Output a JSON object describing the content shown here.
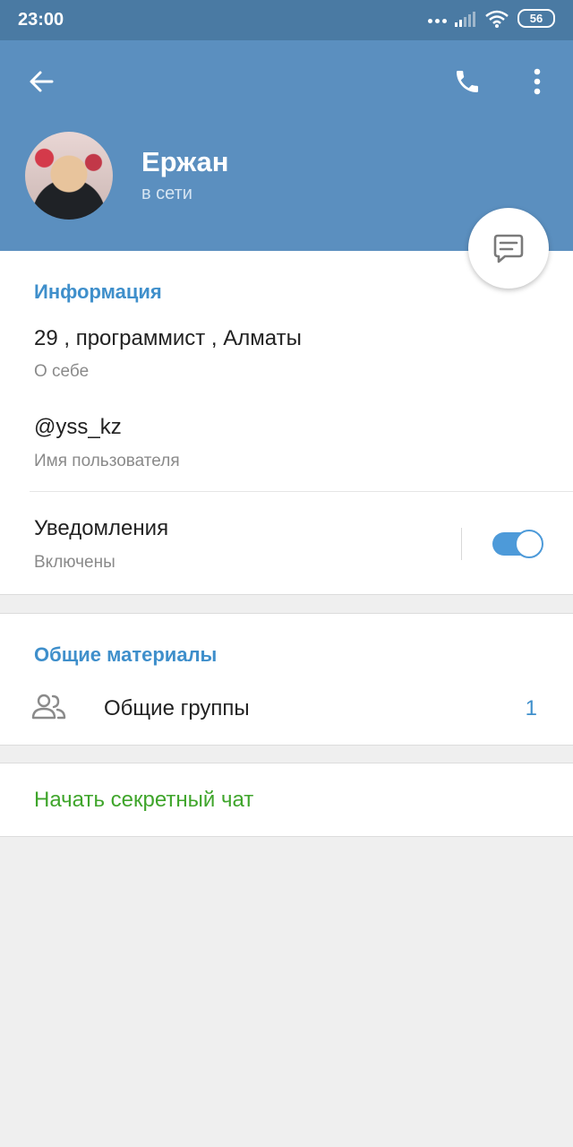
{
  "statusbar": {
    "time": "23:00",
    "battery": "56"
  },
  "header": {
    "name": "Ержан",
    "status": "в сети"
  },
  "info": {
    "section_title": "Информация",
    "bio_value": "29 , программист , Алматы",
    "bio_label": "О себе",
    "username_value": "@yss_kz",
    "username_label": "Имя пользователя",
    "notifications_label": "Уведомления",
    "notifications_state": "Включены"
  },
  "shared": {
    "section_title": "Общие материалы",
    "groups_label": "Общие группы",
    "groups_count": "1"
  },
  "secret_chat": {
    "label": "Начать секретный чат"
  },
  "colors": {
    "header": "#5b8fbf",
    "statusbar": "#4a7aa3",
    "accent": "#3f8fcb",
    "secret": "#3fa52b"
  },
  "icons": [
    "back-arrow-icon",
    "phone-icon",
    "more-vert-icon",
    "message-icon",
    "groups-icon",
    "wifi-icon",
    "signal-icon"
  ]
}
